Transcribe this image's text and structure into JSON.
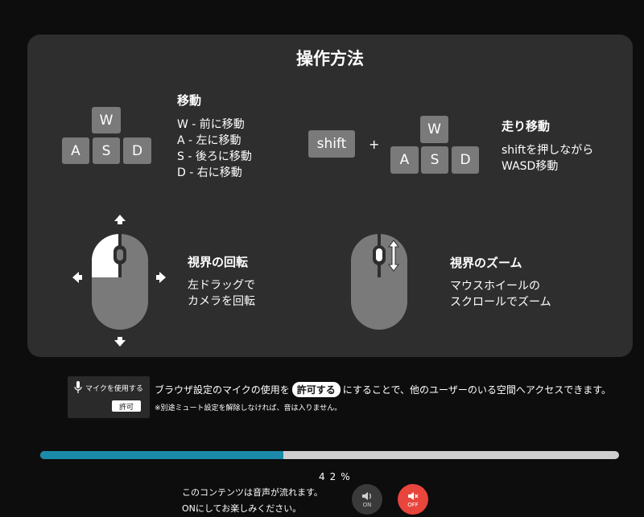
{
  "title": "操作方法",
  "move": {
    "keys": {
      "w": "W",
      "a": "A",
      "s": "S",
      "d": "D"
    },
    "title": "移動",
    "lines": [
      "W - 前に移動",
      "A - 左に移動",
      "S - 後ろに移動",
      "D - 右に移動"
    ]
  },
  "run": {
    "shift_key": "shift",
    "plus": "+",
    "keys": {
      "w": "W",
      "a": "A",
      "s": "S",
      "d": "D"
    },
    "title": "走り移動",
    "lines": [
      "shiftを押しながら",
      "WASD移動"
    ]
  },
  "rotate": {
    "title": "視界の回転",
    "lines": [
      "左ドラッグで",
      "カメラを回転"
    ]
  },
  "zoom": {
    "title": "視界のズーム",
    "lines": [
      "マウスホイールの",
      "スクロールでズーム"
    ]
  },
  "mic": {
    "label": "マイクを使用する",
    "allow": "許可",
    "notice_before": "ブラウザ設定のマイクの使用を",
    "notice_pill": "許可する",
    "notice_after": "にすることで、他のユーザーのいる空間へアクセスできます。",
    "sub_note": "※別途ミュート設定を解除しなければ、音は入りません。"
  },
  "progress": {
    "value": 0.42,
    "label": "42%"
  },
  "audio": {
    "line1": "このコンテンツは音声が流れます。",
    "line2": "ONにしてお楽しみください。",
    "on_label": "ON",
    "off_label": "OFF"
  },
  "colors": {
    "accent": "#1a8aa8",
    "off": "#e8453c"
  }
}
